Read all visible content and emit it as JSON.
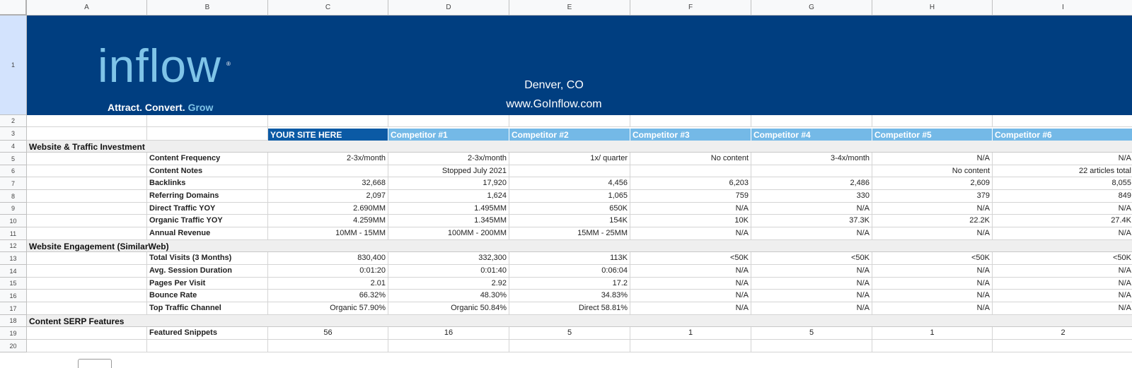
{
  "columns": [
    "A",
    "B",
    "C",
    "D",
    "E",
    "F",
    "G",
    "H",
    "I"
  ],
  "rows": [
    "1",
    "2",
    "3",
    "4",
    "5",
    "6",
    "7",
    "8",
    "9",
    "10",
    "11",
    "12",
    "13",
    "14",
    "15",
    "16",
    "17",
    "18",
    "19",
    "20"
  ],
  "banner": {
    "logo": "inflow",
    "tagline_white": "Attract. Convert.",
    "tagline_accent": "Grow",
    "city": "Denver, CO",
    "website": "www.GoInflow.com"
  },
  "header_row": [
    "YOUR SITE HERE",
    "Competitor #1",
    "Competitor #2",
    "Competitor #3",
    "Competitor #4",
    "Competitor #5",
    "Competitor #6"
  ],
  "sections": {
    "traffic": "Website & Traffic Investment",
    "engagement": "Website Engagement (SimilarWeb)",
    "serp": "Content SERP Features"
  },
  "metrics": [
    {
      "label": "Content Frequency",
      "values": [
        "2-3x/month",
        "2-3x/month",
        "1x/ quarter",
        "No content",
        "3-4x/month",
        "N/A",
        "N/A"
      ]
    },
    {
      "label": "Content Notes",
      "values": [
        "",
        "Stopped July 2021",
        "",
        "",
        "",
        "No content",
        "22 articles total"
      ]
    },
    {
      "label": "Backlinks",
      "values": [
        "32,668",
        "17,920",
        "4,456",
        "6,203",
        "2,486",
        "2,609",
        "8,055"
      ]
    },
    {
      "label": "Referring Domains",
      "values": [
        "2,097",
        "1,624",
        "1,065",
        "759",
        "330",
        "379",
        "849"
      ]
    },
    {
      "label": "Direct Traffic YOY",
      "values": [
        "2.690MM",
        "1.495MM",
        "650K",
        "N/A",
        "N/A",
        "N/A",
        "N/A"
      ]
    },
    {
      "label": "Organic Traffic YOY",
      "values": [
        "4.259MM",
        "1.345MM",
        "154K",
        "10K",
        "37.3K",
        "22.2K",
        "27.4K"
      ]
    },
    {
      "label": "Annual Revenue",
      "values": [
        "10MM - 15MM",
        "100MM - 200MM",
        "15MM - 25MM",
        "N/A",
        "N/A",
        "N/A",
        "N/A"
      ]
    }
  ],
  "engagement": [
    {
      "label": "Total Visits (3 Months)",
      "values": [
        "830,400",
        "332,300",
        "113K",
        "<50K",
        "<50K",
        "<50K",
        "<50K"
      ]
    },
    {
      "label": "Avg. Session Duration",
      "values": [
        "0:01:20",
        "0:01:40",
        "0:06:04",
        "N/A",
        "N/A",
        "N/A",
        "N/A"
      ]
    },
    {
      "label": "Pages Per Visit",
      "values": [
        "2.01",
        "2.92",
        "17.2",
        "N/A",
        "N/A",
        "N/A",
        "N/A"
      ]
    },
    {
      "label": "Bounce Rate",
      "values": [
        "66.32%",
        "48.30%",
        "34.83%",
        "N/A",
        "N/A",
        "N/A",
        "N/A"
      ]
    },
    {
      "label": "Top Traffic Channel",
      "values": [
        "Organic 57.90%",
        "Organic 50.84%",
        "Direct 58.81%",
        "N/A",
        "N/A",
        "N/A",
        "N/A"
      ]
    }
  ],
  "serp": [
    {
      "label": "Featured Snippets",
      "values": [
        "56",
        "16",
        "5",
        "1",
        "5",
        "1",
        "2"
      ]
    }
  ]
}
